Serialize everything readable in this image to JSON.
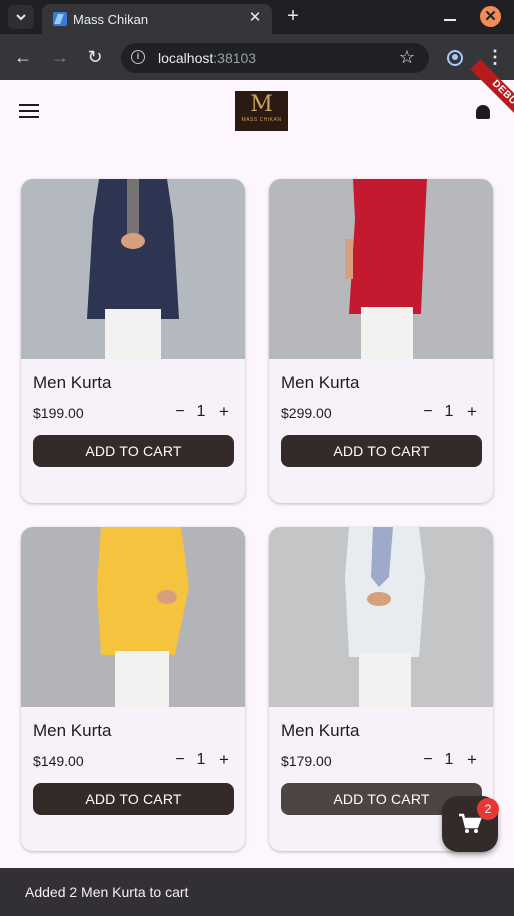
{
  "browser": {
    "tab_title": "Mass Chikan",
    "tab_close": "✕",
    "new_tab": "+",
    "url_host": "localhost",
    "url_port": ":38103",
    "window_close": "✕"
  },
  "app": {
    "logo_mark": "M",
    "logo_text": "MASS CHIKAN",
    "debug_banner": "DEBUG"
  },
  "products": [
    {
      "name": "Men Kurta",
      "price": "$199.00",
      "quantity": "1",
      "button": "ADD TO CART",
      "color": "#2d3552"
    },
    {
      "name": "Men Kurta",
      "price": "$299.00",
      "quantity": "1",
      "button": "ADD TO CART",
      "color": "#c41a30"
    },
    {
      "name": "Men Kurta",
      "price": "$149.00",
      "quantity": "1",
      "button": "ADD TO CART",
      "color": "#f6c33e"
    },
    {
      "name": "Men Kurta",
      "price": "$179.00",
      "quantity": "1",
      "button": "ADD TO CART",
      "color": "#e8ecef"
    }
  ],
  "qty_minus": "−",
  "qty_plus": "+",
  "cart": {
    "badge_count": "2"
  },
  "snackbar": {
    "message": "Added 2 Men Kurta to cart"
  },
  "colors": {
    "background": "#fdf7fd",
    "button": "#342a2a",
    "badge": "#e53935",
    "snackbar": "#322f35"
  }
}
